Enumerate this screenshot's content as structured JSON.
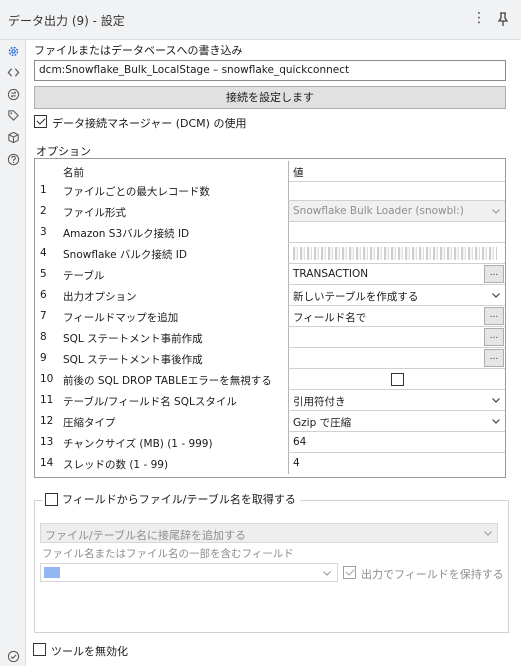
{
  "window": {
    "title": "データ出力 (9) - 設定",
    "more_icon": "more-vertical-icon",
    "pin_icon": "pin-icon"
  },
  "sidebar_icons": [
    "gear-icon",
    "code-icon",
    "swap-icon",
    "tag-icon",
    "cube-icon",
    "help-icon",
    "check-circle-icon"
  ],
  "write_section": {
    "label": "ファイルまたはデータベースへの書き込み",
    "connection_value": "dcm:Snowflake_Bulk_LocalStage – snowflake_quickconnect",
    "set_connection_button": "接続を設定します",
    "dcm_checkbox_label": "データ接続マネージャー (DCM) の使用",
    "dcm_checked": true
  },
  "options": {
    "label": "オプション",
    "header_name": "名前",
    "header_value": "値",
    "rows": [
      {
        "num": "1",
        "name": "ファイルごとの最大レコード数",
        "value": ""
      },
      {
        "num": "2",
        "name": "ファイル形式",
        "value": "Snowflake Bulk Loader (snowbl:)"
      },
      {
        "num": "3",
        "name": "Amazon S3バルク接続 ID",
        "value": ""
      },
      {
        "num": "4",
        "name": "Snowflake バルク接続 ID",
        "value": ""
      },
      {
        "num": "5",
        "name": "テーブル",
        "value": "TRANSACTION"
      },
      {
        "num": "6",
        "name": "出力オプション",
        "value": "新しいテーブルを作成する"
      },
      {
        "num": "7",
        "name": "フィールドマップを追加",
        "value": "フィールド名で"
      },
      {
        "num": "8",
        "name": "SQL ステートメント事前作成",
        "value": ""
      },
      {
        "num": "9",
        "name": "SQL ステートメント事後作成",
        "value": ""
      },
      {
        "num": "10",
        "name": "前後の SQL DROP TABLEエラーを無視する",
        "value": ""
      },
      {
        "num": "11",
        "name": "テーブル/フィールド名 SQLスタイル",
        "value": "引用符付き"
      },
      {
        "num": "12",
        "name": "圧縮タイプ",
        "value": "Gzip で圧縮"
      },
      {
        "num": "13",
        "name": "チャンクサイズ (MB) (1 - 999)",
        "value": "64"
      },
      {
        "num": "14",
        "name": "スレッドの数 (1 - 99)",
        "value": "4"
      }
    ],
    "ellipsis": "..."
  },
  "filename_group": {
    "checkbox_label": "フィールドからファイル/テーブル名を取得する",
    "checked": false,
    "mode_select": "ファイル/テーブル名に接尾辞を追加する",
    "field_label": "ファイル名またはファイル名の一部を含むフィールド",
    "keep_field_label": "出力でフィールドを保持する",
    "keep_field_checked": true
  },
  "disable_tool": {
    "label": "ツールを無効化",
    "checked": false
  },
  "colors": {
    "titlebar_bg": "#f1f2f4",
    "accent_blue": "#3b78e7",
    "disabled_text": "#8e8e8e"
  }
}
